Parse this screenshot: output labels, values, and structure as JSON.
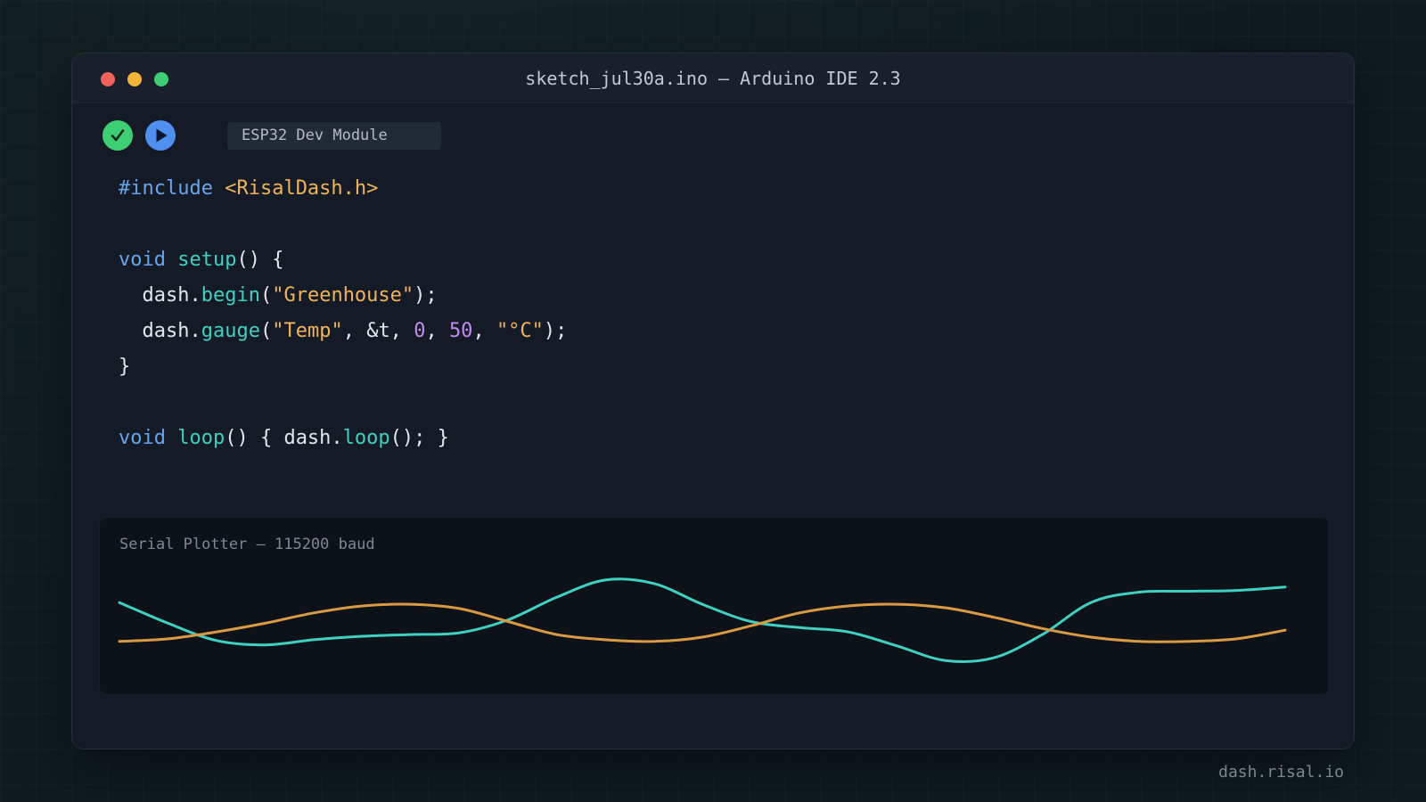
{
  "window": {
    "title": "sketch_jul30a.ino — Arduino IDE 2.3"
  },
  "toolbar": {
    "verify_icon": "checkmark-icon",
    "upload_icon": "play-arrow-icon",
    "board": "ESP32 Dev Module"
  },
  "colors": {
    "close": "#f0625a",
    "minimize": "#f4b43a",
    "maximize": "#3ecf74",
    "verify": "#3ecf74",
    "upload": "#4f8ff0",
    "series_teal": "#3fd0c2",
    "series_orange": "#d99a44"
  },
  "code": {
    "l1_kw": "#include",
    "l1_str": "<RisalDash.h>",
    "l3_kw": "void",
    "l3_fn": "setup",
    "l3_rest": "() {",
    "l4_obj": "dash.",
    "l4_fn": "begin",
    "l4_p1": "(",
    "l4_str": "\"Greenhouse\"",
    "l4_p2": ");",
    "l5_obj": "dash.",
    "l5_fn": "gauge",
    "l5_p1": "(",
    "l5_s1": "\"Temp\"",
    "l5_p2": ", &t, ",
    "l5_n1": "0",
    "l5_p3": ", ",
    "l5_n2": "50",
    "l5_p4": ", ",
    "l5_s2": "\"°C\"",
    "l5_p5": ");",
    "l6": "}",
    "l8_kw": "void",
    "l8_fn": "loop",
    "l8_p1": "() { dash.",
    "l8_fn2": "loop",
    "l8_p2": "(); }"
  },
  "plotter": {
    "title": "Serial Plotter — 115200 baud"
  },
  "chart_data": {
    "type": "line",
    "series": [
      {
        "color": "#3fd0c2",
        "values": [
          0.72,
          0.48,
          0.28,
          0.23,
          0.29,
          0.33,
          0.35,
          0.37,
          0.52,
          0.78,
          0.98,
          0.94,
          0.7,
          0.5,
          0.43,
          0.38,
          0.22,
          0.05,
          0.08,
          0.35,
          0.72,
          0.84,
          0.85,
          0.86,
          0.9
        ]
      },
      {
        "color": "#d99a44",
        "values": [
          0.27,
          0.3,
          0.38,
          0.48,
          0.6,
          0.68,
          0.7,
          0.65,
          0.5,
          0.35,
          0.29,
          0.27,
          0.32,
          0.45,
          0.6,
          0.68,
          0.7,
          0.66,
          0.55,
          0.42,
          0.32,
          0.27,
          0.27,
          0.3,
          0.4
        ]
      }
    ],
    "ylim": [
      0,
      1
    ],
    "grid": false,
    "legend": "none"
  },
  "footer": {
    "text": "dash.risal.io"
  }
}
